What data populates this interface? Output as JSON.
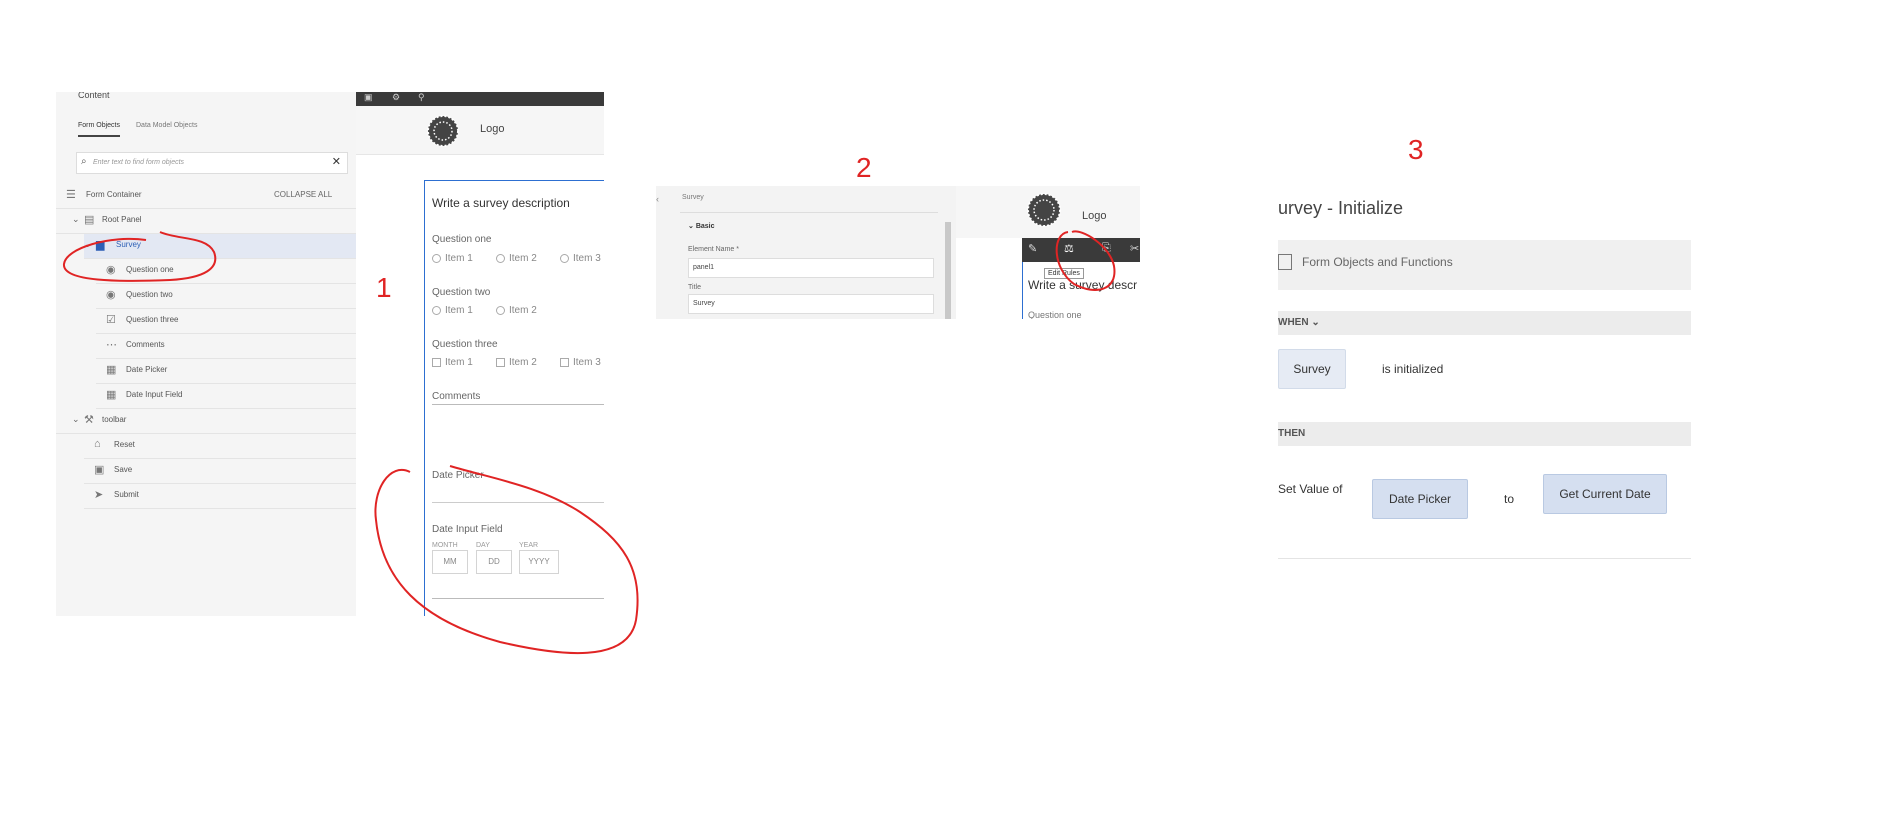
{
  "labels": {
    "one": "1",
    "two": "2",
    "three": "3"
  },
  "panel1": {
    "sidebar": {
      "title": "Content",
      "tabs": [
        "Form Objects",
        "Data Model Objects"
      ],
      "search_placeholder": "Enter text to find form objects",
      "tree": [
        {
          "label": "Form Container",
          "icon": "container-icon",
          "indent": 0,
          "action": "COLLAPSE ALL"
        },
        {
          "label": "Root Panel",
          "icon": "panel-icon",
          "indent": 1
        },
        {
          "label": "Survey",
          "icon": "panel-icon",
          "indent": 2
        },
        {
          "label": "Question one",
          "icon": "radio-icon",
          "indent": 3
        },
        {
          "label": "Question two",
          "icon": "radio-icon",
          "indent": 3
        },
        {
          "label": "Question three",
          "icon": "checkbox-icon",
          "indent": 3
        },
        {
          "label": "Comments",
          "icon": "textfield-icon",
          "indent": 3
        },
        {
          "label": "Date Picker",
          "icon": "calendar-icon",
          "indent": 3
        },
        {
          "label": "Date Input Field",
          "icon": "calendar-icon",
          "indent": 3
        },
        {
          "label": "toolbar",
          "icon": "tools-icon",
          "indent": 1
        },
        {
          "label": "Reset",
          "icon": "reset-icon",
          "indent": 2
        },
        {
          "label": "Save",
          "icon": "save-icon",
          "indent": 2
        },
        {
          "label": "Submit",
          "icon": "submit-icon",
          "indent": 2
        }
      ]
    },
    "canvas": {
      "logo_text": "Logo",
      "survey_title": "Write a survey description",
      "q1": {
        "label": "Question one",
        "options": [
          "Item 1",
          "Item 2",
          "Item 3"
        ]
      },
      "q2": {
        "label": "Question two",
        "options": [
          "Item 1",
          "Item 2"
        ]
      },
      "q3": {
        "label": "Question three",
        "options": [
          "Item 1",
          "Item 2",
          "Item 3"
        ]
      },
      "comments_label": "Comments",
      "date_picker_label": "Date Picker",
      "date_input": {
        "label": "Date Input Field",
        "captions": [
          "MONTH",
          "DAY",
          "YEAR"
        ],
        "placeholders": [
          "MM",
          "DD",
          "YYYY"
        ]
      }
    }
  },
  "panel2": {
    "prop_title": "Survey",
    "section": "Basic",
    "element_name_label": "Element Name *",
    "element_name_value": "panel1",
    "title_label": "Title",
    "title_value": "Survey",
    "logo_text": "Logo",
    "tooltip": "Edit Rules",
    "survey_title": "Write a survey descr",
    "question_peek": "Question one"
  },
  "panel3": {
    "title": "urvey - Initialize",
    "tab": "Form Objects and Functions",
    "when_label": "WHEN",
    "when_chip": "Survey",
    "when_text": "is initialized",
    "then_label": "THEN",
    "set_value_text": "Set Value of",
    "target_chip": "Date Picker",
    "to_text": "to",
    "value_chip": "Get Current Date"
  },
  "colors": {
    "annotation": "#e02424",
    "chip": "#d5dff0",
    "toolbar": "#3a3a3a",
    "selected_row": "#e3e8f3"
  }
}
